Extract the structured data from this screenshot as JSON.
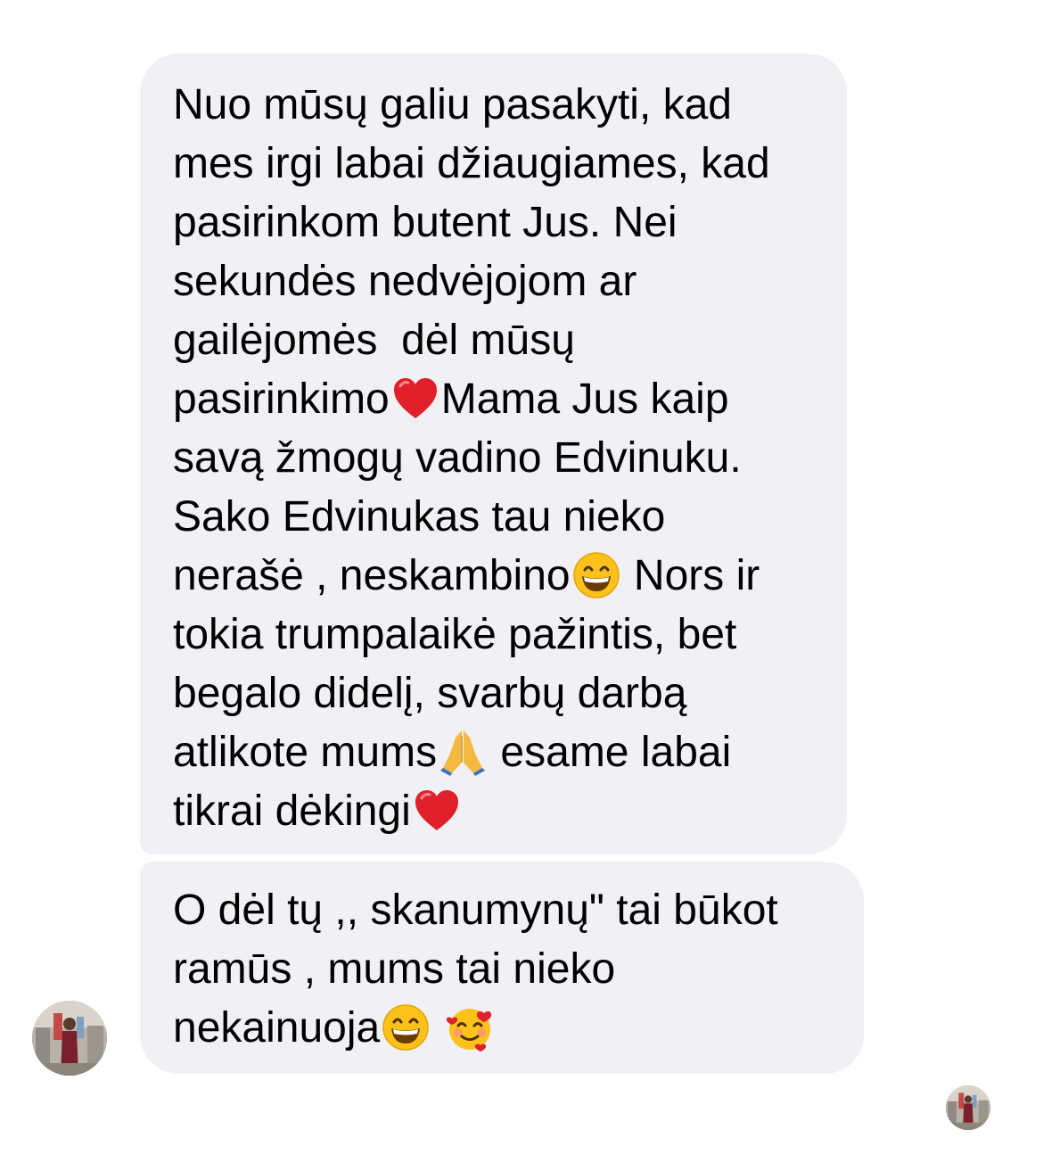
{
  "messages": [
    {
      "lines": [
        [
          "Nuo mūsų galiu pasakyti, kad"
        ],
        [
          "mes irgi labai džiaugiames, kad"
        ],
        [
          "pasirinkom butent Jus. Nei"
        ],
        [
          "sekundės nedvėjojom ar"
        ],
        [
          "gailėjomės  dėl mūsų"
        ],
        [
          "pasirinkimo",
          {
            "emoji": "red-heart"
          },
          "Mama Jus kaip"
        ],
        [
          "savą žmogų vadino Edvinuku."
        ],
        [
          "Sako Edvinukas tau nieko"
        ],
        [
          "nerašė , neskambino",
          {
            "emoji": "grinning-face"
          },
          " Nors ir"
        ],
        [
          "tokia trumpalaikė pažintis, bet"
        ],
        [
          "begalo didelį, svarbų darbą"
        ],
        [
          "atlikote mums",
          {
            "emoji": "folded-hands"
          },
          " esame labai"
        ],
        [
          "tikrai dėkingi",
          {
            "emoji": "red-heart"
          }
        ]
      ]
    },
    {
      "lines": [
        [
          "O dėl tų ,, skanumynų\" tai būkot"
        ],
        [
          "ramūs , mums tai nieko"
        ],
        [
          "nekainuoja",
          {
            "emoji": "grinning-face"
          },
          " ",
          {
            "emoji": "smiling-face-with-hearts"
          }
        ]
      ]
    }
  ],
  "avatars": {
    "sender": "profile-photo-icon",
    "read_receipt": "profile-photo-icon"
  },
  "colors": {
    "bubble_background": "#f0f0f5",
    "text": "#000000",
    "page_background": "#ffffff"
  }
}
